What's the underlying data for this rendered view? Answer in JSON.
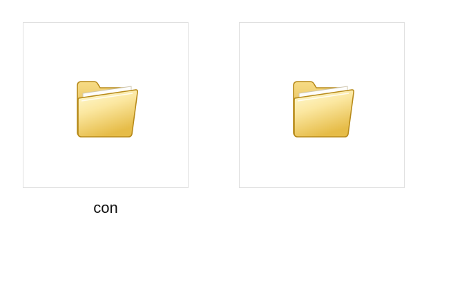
{
  "folders": [
    {
      "label": "con",
      "icon": "folder-icon"
    },
    {
      "label": "",
      "icon": "folder-icon"
    }
  ],
  "colors": {
    "folder_front_light": "#fff6b8",
    "folder_front_dark": "#e9c24c",
    "folder_back": "#f2d277",
    "folder_outline": "#b78a1a",
    "tile_border": "#e0e0e0"
  }
}
